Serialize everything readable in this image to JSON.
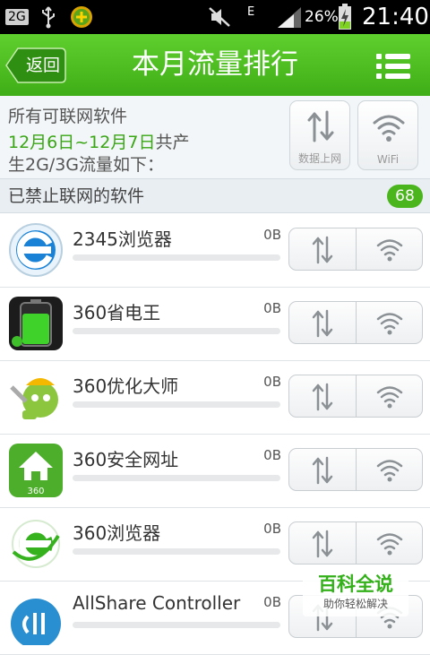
{
  "status_bar": {
    "battery_percent": "26%",
    "time": "21:40",
    "network_type": "E",
    "sim_indicator": "2G"
  },
  "header": {
    "back_label": "返回",
    "title": "本月流量排行"
  },
  "summary": {
    "line1": "所有可联网软件",
    "date_range": "12月6日~12月7日",
    "line2_suffix": "共产",
    "line3": "生2G/3G流量如下：",
    "mobile_label": "数据上网",
    "wifi_label": "WiFi"
  },
  "section": {
    "label": "已禁止联网的软件",
    "count": "68"
  },
  "apps": [
    {
      "name": "2345浏览器",
      "usage": "0B",
      "icon": "browser-2345-icon",
      "usage_fraction": 0
    },
    {
      "name": "360省电王",
      "usage": "0B",
      "icon": "battery-saver-icon",
      "usage_fraction": 0
    },
    {
      "name": "360优化大师",
      "usage": "0B",
      "icon": "optimizer-icon",
      "usage_fraction": 0
    },
    {
      "name": "360安全网址",
      "usage": "0B",
      "icon": "home-360-icon",
      "usage_fraction": 0
    },
    {
      "name": "360浏览器",
      "usage": "0B",
      "icon": "browser-360-icon",
      "usage_fraction": 0
    },
    {
      "name": "AllShare Controller",
      "usage": "0B",
      "icon": "allshare-icon",
      "usage_fraction": 0
    }
  ],
  "watermark": {
    "title": "百科全说",
    "subtitle": "助你轻松解决"
  },
  "colors": {
    "header_green": "#4cbd22",
    "accent_green": "#3aa515",
    "badge_green": "#4bb51e"
  }
}
